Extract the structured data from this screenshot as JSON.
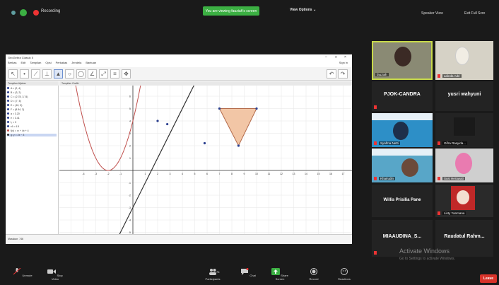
{
  "topbar": {
    "recording": "Recording",
    "viewing": "You are viewing fauziah's screen",
    "view_options": "View Options ⌄",
    "speaker_view": "Speaker View",
    "exit_full": "Exit Full Scre"
  },
  "geogebra": {
    "title": "GeoGebra Classic 5",
    "menus": [
      "Berkas",
      "Edit",
      "Tampilan",
      "Opsi",
      "Perkakas",
      "Jendela",
      "Bantuan"
    ],
    "signin": "Sign in",
    "algebra_header": "Tampilan Aljabar",
    "graphics_header": "Tampilan Grafik",
    "algebra_items": [
      "A = (2, 4)",
      "B = (3, 2)",
      "C = (2.78, 3.74)",
      "D = (7, 5)",
      "E = (10, 5)",
      "F = (8.54, 2)",
      "a = 3.20",
      "e = 3.41",
      "f₁ = 3",
      "r4 = 4.5",
      "f(x) = x² + 4x + 4",
      "g: y = 2x − 3"
    ],
    "input_label": "Masukan: 746",
    "x_ticks": [
      "-4",
      "-3",
      "-2",
      "-1",
      "0",
      "1",
      "2",
      "3",
      "4",
      "5",
      "6",
      "7",
      "8",
      "9",
      "10",
      "11",
      "12",
      "13",
      "14",
      "15",
      "16",
      "17",
      "18"
    ],
    "y_ticks": [
      "6",
      "5",
      "4",
      "3",
      "2",
      "1",
      "-1",
      "-2",
      "-3",
      "-4",
      "-5"
    ]
  },
  "participants": [
    {
      "name": "fauziah"
    },
    {
      "name": "adinda Adri"
    },
    {
      "name": "PJOK-CANDRA"
    },
    {
      "name": "yusri wahyuni"
    },
    {
      "name": "Syafma Netti"
    },
    {
      "name": "Gifra Rasyida..."
    },
    {
      "name": "Khairudin"
    },
    {
      "name": "Susi Herawati"
    },
    {
      "name": "Willis Prisilia Pane"
    },
    {
      "name": "Listy Yanmana"
    },
    {
      "name": "MIAAUDINA_S..."
    },
    {
      "name": "Raudatul Rahm..."
    }
  ],
  "watermark": {
    "title": "Activate Windows",
    "sub": "Go to Settings to activate Windows."
  },
  "bottombar": {
    "unmute": "Unmute",
    "stop_video": "Stop Video",
    "participants": "Participants",
    "participants_count": "76",
    "chat": "Chat",
    "share": "Share Screen",
    "record": "Record",
    "reactions": "Reactions",
    "leave": "Leave"
  },
  "colors": {
    "accent_green": "#3cb043",
    "leave_red": "#d8332a",
    "parabola": "#c0504d",
    "triangle_fill": "#f2c6a6",
    "triangle_stroke": "#b36a4a"
  }
}
